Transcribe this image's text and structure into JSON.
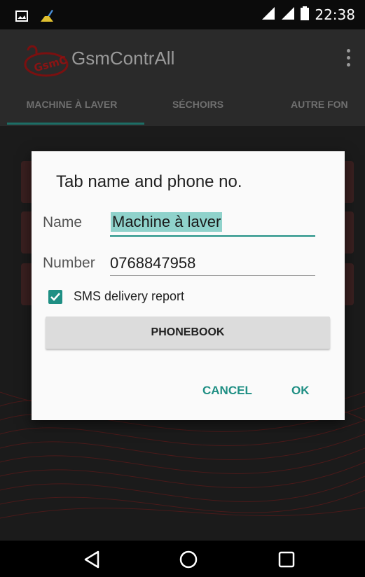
{
  "status_bar": {
    "time": "22:38",
    "icons": [
      "image-notification-icon",
      "cleaner-notification-icon",
      "signal-icon",
      "signal-icon",
      "battery-icon"
    ]
  },
  "app_bar": {
    "title": "GsmContrAll",
    "logo_text": "GsmC",
    "overflow_icon": "overflow-menu-icon"
  },
  "tabs": [
    {
      "label": "MACHINE À LAVER",
      "selected": true
    },
    {
      "label": "SÉCHOIRS",
      "selected": false
    },
    {
      "label": "AUTRE FON",
      "selected": false
    }
  ],
  "dialog": {
    "title": "Tab name and phone no.",
    "name_label": "Name",
    "name_value": "Machine à laver",
    "number_label": "Number",
    "number_value": "0768847958",
    "sms_checkbox_label": "SMS delivery report",
    "sms_checked": true,
    "phonebook_button": "PHONEBOOK",
    "cancel_button": "CANCEL",
    "ok_button": "OK"
  },
  "nav_bar": {
    "icons": [
      "back-icon",
      "home-icon",
      "recents-icon"
    ]
  },
  "colors": {
    "accent": "#1f8f84",
    "selection": "#8fd2cb",
    "appbar": "#2a2a2a"
  }
}
